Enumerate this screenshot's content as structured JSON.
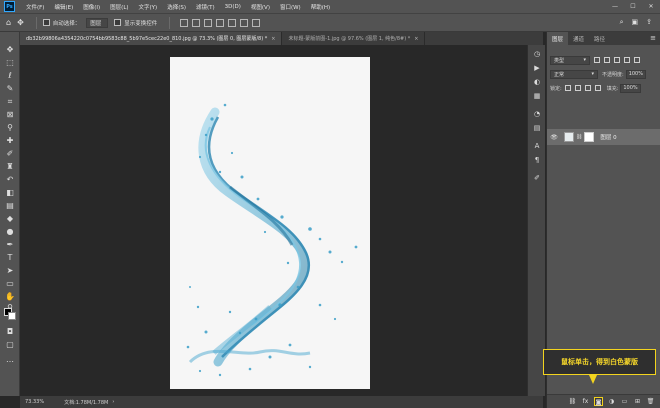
{
  "menubar": {
    "logo": "Ps",
    "items": [
      "文件(F)",
      "编辑(E)",
      "图像(I)",
      "图层(L)",
      "文字(Y)",
      "选择(S)",
      "滤镜(T)",
      "3D(D)",
      "视图(V)",
      "窗口(W)",
      "帮助(H)"
    ],
    "minimize": "—",
    "maximize": "☐",
    "close": "✕"
  },
  "options": {
    "auto_select_label": "自动选择：",
    "auto_select_value": "图层",
    "transform_label": "显示变换控件"
  },
  "tabs": [
    {
      "label": "db32b99806a4354220c0754bb9583c88_5b97e5cec22e0_810.jpg @ 73.3% (图层 0, 图层蒙版/8) *",
      "close": "×"
    },
    {
      "label": "未标题-蒙版前图-1.jpg @ 97.6% (图层 1, 纯色/8#) *",
      "close": "×"
    }
  ],
  "statusbar": {
    "zoom": "73.33%",
    "doc": "文档:1.78M/1.78M",
    "arrow": "›"
  },
  "layers_panel": {
    "tabs": [
      "图层",
      "通道",
      "路径"
    ],
    "menu": "≡",
    "filter_kind": "类型",
    "blend_mode": "正常",
    "opacity_label": "不透明度:",
    "opacity_value": "100%",
    "lock_label": "锁定:",
    "fill_label": "填充:",
    "fill_value": "100%",
    "layer_name": "图层 0"
  },
  "callout": {
    "text": "鼠标单击，得到白色蒙版"
  },
  "colors": {
    "accent": "#f3d41e",
    "water": "#3b9fc8"
  }
}
